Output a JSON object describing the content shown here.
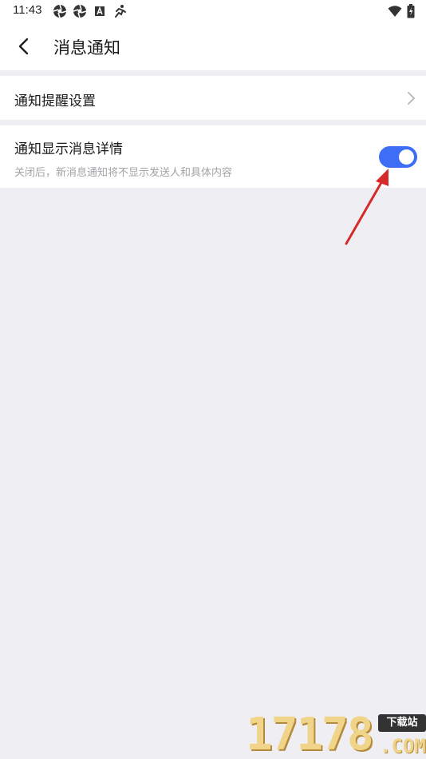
{
  "status_bar": {
    "time": "11:43",
    "icons": [
      "aperture-icon",
      "aperture-icon",
      "a-box-icon",
      "running-icon"
    ],
    "right_icons": [
      "wifi-icon",
      "battery-charging-icon"
    ]
  },
  "header": {
    "title": "消息通知",
    "back_icon": "back-arrow-icon"
  },
  "settings": {
    "reminder_label": "通知提醒设置",
    "detail_label": "通知显示消息详情",
    "detail_description": "关闭后，新消息通知将不显示发送人和具体内容",
    "detail_toggle_on": true
  },
  "colors": {
    "accent": "#3d6ef5",
    "background": "#efeef3",
    "annotation": "#d42a2a"
  },
  "watermark": {
    "digits": "17178",
    "badge": "下载站",
    "suffix": ".COM"
  }
}
